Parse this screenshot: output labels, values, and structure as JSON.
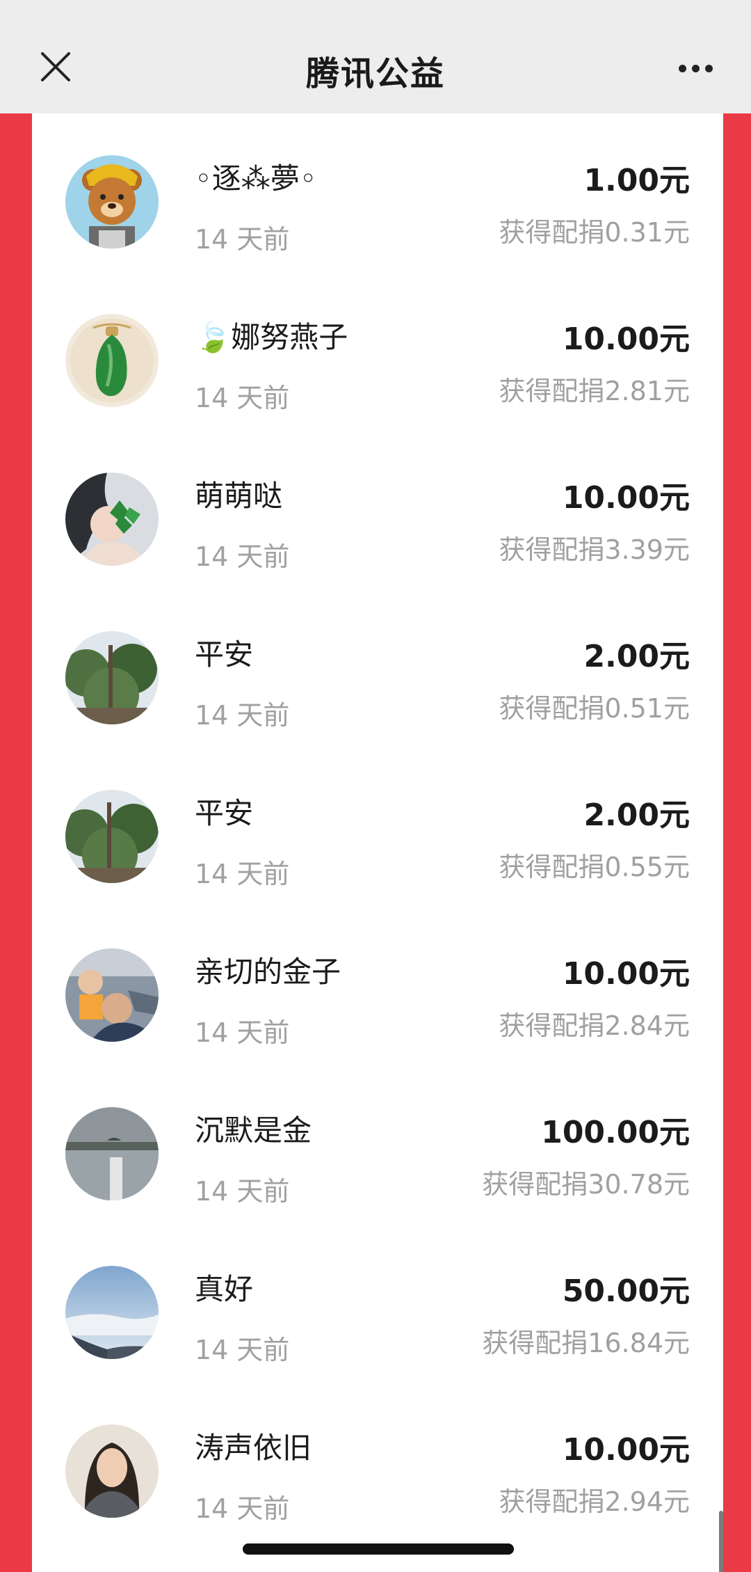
{
  "header": {
    "title": "腾讯公益"
  },
  "donations": [
    {
      "name": "◦逐⁂夢◦",
      "time": "14 天前",
      "amount": "1.00元",
      "match": "获得配捐0.31元",
      "avatar": "bear-avatar"
    },
    {
      "name": "娜努燕子",
      "time": "14 天前",
      "amount": "10.00元",
      "match": "获得配捐2.81元",
      "avatar": "jade-pendant-avatar"
    },
    {
      "name": "萌萌哒",
      "time": "14 天前",
      "amount": "10.00元",
      "match": "获得配捐3.39元",
      "avatar": "woman-leaf-avatar"
    },
    {
      "name": "平安",
      "time": "14 天前",
      "amount": "2.00元",
      "match": "获得配捐0.51元",
      "avatar": "tree-avatar"
    },
    {
      "name": "平安",
      "time": "14 天前",
      "amount": "2.00元",
      "match": "获得配捐0.55元",
      "avatar": "tree-avatar"
    },
    {
      "name": "亲切的金子",
      "time": "14 天前",
      "amount": "10.00元",
      "match": "获得配捐2.84元",
      "avatar": "family-photo-avatar"
    },
    {
      "name": "沉默是金",
      "time": "14 天前",
      "amount": "100.00元",
      "match": "获得配捐30.78元",
      "avatar": "lake-avatar"
    },
    {
      "name": "真好",
      "time": "14 天前",
      "amount": "50.00元",
      "match": "获得配捐16.84元",
      "avatar": "sky-clouds-avatar"
    },
    {
      "name": "涛声依旧",
      "time": "14 天前",
      "amount": "10.00元",
      "match": "获得配捐2.94元",
      "avatar": "woman-portrait-avatar"
    }
  ]
}
